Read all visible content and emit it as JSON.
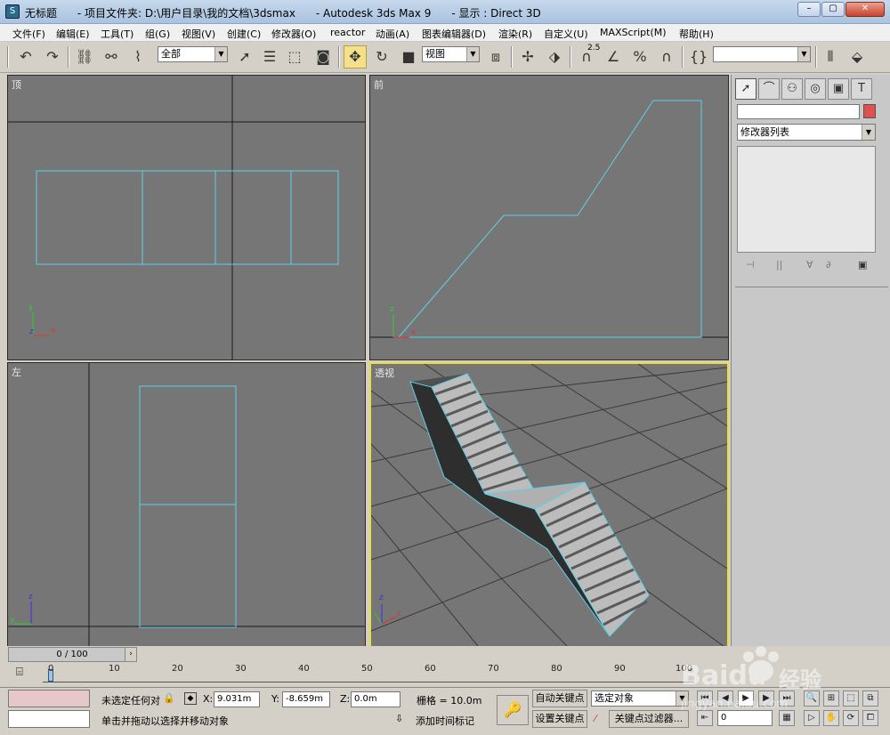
{
  "title_bar": {
    "icon": "3dsmax-icon",
    "text": "无标题      - 项目文件夹: D:\\用户目录\\我的文档\\3dsmax      - Autodesk 3ds Max 9      - 显示 : Direct 3D"
  },
  "menu": [
    "文件(F)",
    "编辑(E)",
    "工具(T)",
    "组(G)",
    "视图(V)",
    "创建(C)",
    "修改器(O)",
    "reactor",
    "动画(A)",
    "图表编辑器(D)",
    "渲染(R)",
    "自定义(U)",
    "MAXScript(M)",
    "帮助(H)"
  ],
  "toolbar": {
    "selection_filter": "全部",
    "ref_coord": "视图",
    "named_selection": "",
    "snap_angle": "2.5"
  },
  "viewports": {
    "top": "顶",
    "front": "前",
    "left": "左",
    "perspective": "透视"
  },
  "axis": {
    "x": "x",
    "y": "y",
    "z": "z"
  },
  "command_panel": {
    "modifier_list": "修改器列表"
  },
  "timeline": {
    "slider": "0 / 100",
    "ticks": [
      "0",
      "10",
      "20",
      "30",
      "40",
      "50",
      "60",
      "70",
      "80",
      "90",
      "100"
    ]
  },
  "status": {
    "selection": "未选定任何对",
    "prompt": "单击并拖动以选择并移动对象",
    "x_label": "X:",
    "x": "9.031m",
    "y_label": "Y:",
    "y": "-8.659m",
    "z_label": "Z:",
    "z": "0.0m",
    "grid": "栅格 = 10.0m",
    "add_time_tag": "添加时间标记",
    "auto_key": "自动关键点",
    "set_key": "设置关键点",
    "key_mode": "选定对象",
    "key_filters": "关键点过滤器...",
    "frame": "0"
  },
  "watermark": {
    "brand": "Baidu",
    "brand_cn": "经验",
    "url": "jingyan.baidu.com"
  },
  "colors": {
    "viewport_bg": "#767676",
    "wire": "#5fd0e8",
    "active_border": "#e6df3c",
    "object_color": "#e05050"
  }
}
